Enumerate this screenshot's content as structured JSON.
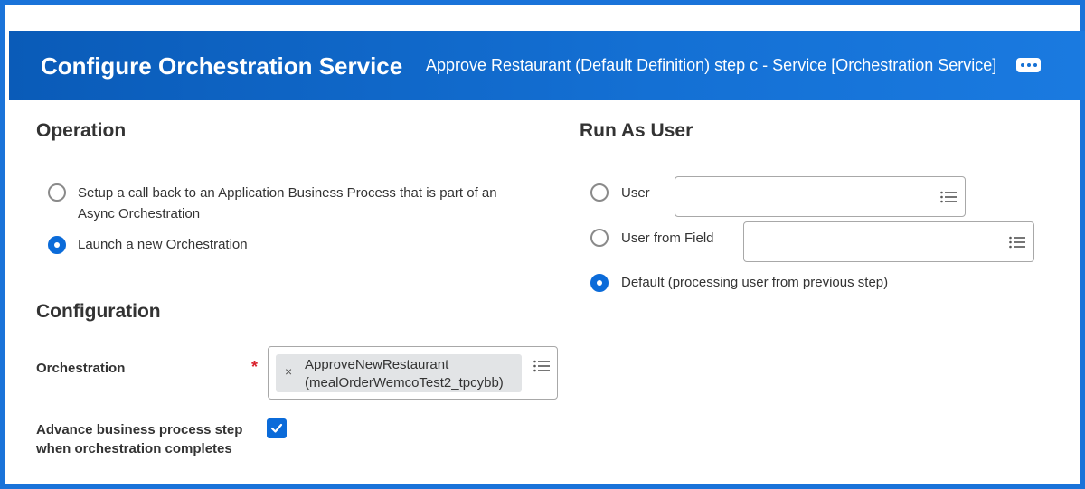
{
  "header": {
    "title": "Configure Orchestration Service",
    "subtitle": "Approve Restaurant (Default Definition) step c - Service [Orchestration Service]",
    "more_icon": "more-horizontal-icon"
  },
  "operation": {
    "title": "Operation",
    "options": [
      {
        "line1": "Setup a call back to an Application Business Process that is part of an",
        "line2": "Async Orchestration",
        "selected": false
      },
      {
        "line1": "Launch a new Orchestration",
        "selected": true
      }
    ]
  },
  "configuration": {
    "title": "Configuration",
    "orchestration_label": "Orchestration",
    "required_mark": "*",
    "orchestration_value_line1": "ApproveNewRestaurant",
    "orchestration_value_line2": "(mealOrderWemcoTest2_tpcybb)",
    "remove_glyph": "×",
    "advance_label_line1": "Advance business process step",
    "advance_label_line2": "when orchestration completes",
    "advance_checked": true
  },
  "run_as_user": {
    "title": "Run As User",
    "options": [
      {
        "label": "User",
        "selected": false,
        "input_value": ""
      },
      {
        "label": "User from Field",
        "selected": false,
        "input_value": ""
      },
      {
        "label": "Default (processing user from previous step)",
        "selected": true
      }
    ]
  },
  "colors": {
    "accent": "#0b6bd9",
    "header": "#0a5bb8",
    "required": "#d9232e"
  }
}
